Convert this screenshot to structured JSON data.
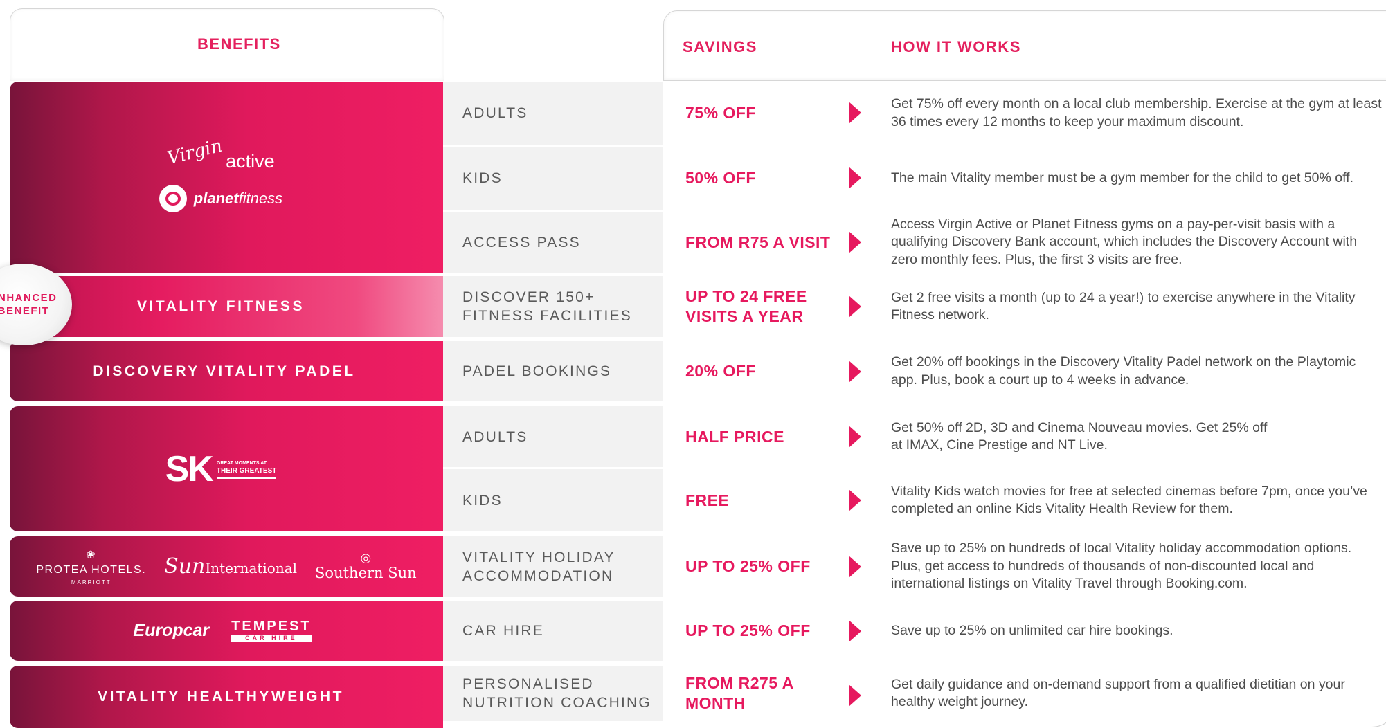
{
  "headers": {
    "benefits": "BENEFITS",
    "savings": "SAVINGS",
    "how_it_works": "HOW IT WORKS"
  },
  "badge": {
    "line1": "ENHANCED",
    "line2": "BENEFIT"
  },
  "logos": {
    "virgin_script": "Virgin",
    "virgin_word": "active",
    "planet_bold": "planet",
    "planet_light": "fitness",
    "sk_letters": "SK",
    "sk_tag_line1": "GREAT MOMENTS AT",
    "sk_tag_line2": "THEIR GREATEST",
    "protea_name": "PROTEA HOTELS.",
    "protea_sub": "MARRIOTT",
    "sun_script": "Sun",
    "sun_word": "International",
    "southern_sun": "Southern Sun",
    "europcar": "Europcar",
    "tempest": "TEMPEST",
    "tempest_sub": "CAR HIRE"
  },
  "categories": {
    "vitality_fitness": "VITALITY FITNESS",
    "padel": "DISCOVERY VITALITY PADEL",
    "healthyweight": "VITALITY HEALTHYWEIGHT"
  },
  "rows": [
    {
      "sub": "ADULTS",
      "savings": "75% OFF",
      "how": "Get 75% off every month on a local club membership. Exercise at the gym at least 36 times every 12 months to keep your maximum discount."
    },
    {
      "sub": "KIDS",
      "savings": "50% OFF",
      "how": "The main Vitality member must be a gym member for the child to get 50% off."
    },
    {
      "sub": "ACCESS PASS",
      "savings": "FROM R75 A VISIT",
      "how": "Access Virgin Active or Planet Fitness gyms on a pay-per-visit basis with a qualifying Discovery Bank account, which includes the Discovery Account with zero monthly fees. Plus, the first 3 visits are free."
    },
    {
      "sub": "DISCOVER 150+ FITNESS FACILITIES",
      "savings": "UP TO 24 FREE VISITS A YEAR",
      "how": "Get 2 free visits a month (up to 24 a year!) to exercise anywhere in the Vitality Fitness network."
    },
    {
      "sub": "PADEL BOOKINGS",
      "savings": "20% OFF",
      "how": "Get 20% off bookings in the Discovery Vitality Padel network on the Playtomic app. Plus, book a court up to 4 weeks in advance."
    },
    {
      "sub": "ADULTS",
      "savings": "HALF PRICE",
      "how": "Get 50% off 2D, 3D and Cinema Nouveau movies. Get 25% off at IMAX, Cine Prestige and NT Live."
    },
    {
      "sub": "KIDS",
      "savings": "FREE",
      "how": "Vitality Kids watch movies for free at selected cinemas before 7pm, once you’ve completed an online Kids Vitality Health Review for them."
    },
    {
      "sub": "VITALITY HOLIDAY ACCOMMODATION",
      "savings": "UP TO 25% OFF",
      "how": "Save up to 25% on hundreds of local Vitality holiday accommodation options. Plus, get access to hundreds of thousands of non-discounted local and international listings on Vitality Travel through Booking.com."
    },
    {
      "sub": "CAR HIRE",
      "savings": "UP TO 25% OFF",
      "how": "Save up to 25% on unlimited car hire bookings."
    },
    {
      "sub": "PERSONALISED NUTRITION COACHING",
      "savings": "FROM R275 A MONTH",
      "how": "Get daily guidance and on-demand support from a qualified dietitian on your healthy weight journey."
    }
  ]
}
